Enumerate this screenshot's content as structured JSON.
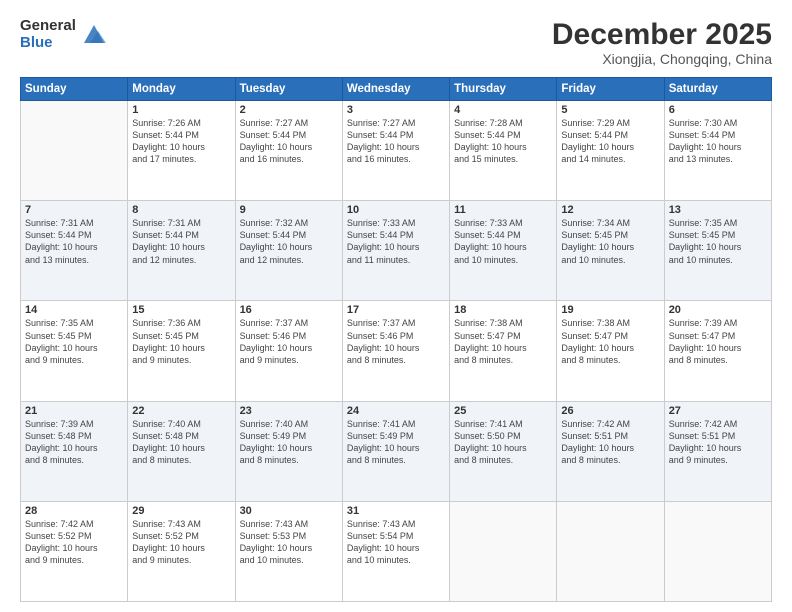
{
  "header": {
    "logo_general": "General",
    "logo_blue": "Blue",
    "month_title": "December 2025",
    "subtitle": "Xiongjia, Chongqing, China"
  },
  "days_of_week": [
    "Sunday",
    "Monday",
    "Tuesday",
    "Wednesday",
    "Thursday",
    "Friday",
    "Saturday"
  ],
  "weeks": [
    [
      {
        "day": "",
        "info": ""
      },
      {
        "day": "1",
        "info": "Sunrise: 7:26 AM\nSunset: 5:44 PM\nDaylight: 10 hours\nand 17 minutes."
      },
      {
        "day": "2",
        "info": "Sunrise: 7:27 AM\nSunset: 5:44 PM\nDaylight: 10 hours\nand 16 minutes."
      },
      {
        "day": "3",
        "info": "Sunrise: 7:27 AM\nSunset: 5:44 PM\nDaylight: 10 hours\nand 16 minutes."
      },
      {
        "day": "4",
        "info": "Sunrise: 7:28 AM\nSunset: 5:44 PM\nDaylight: 10 hours\nand 15 minutes."
      },
      {
        "day": "5",
        "info": "Sunrise: 7:29 AM\nSunset: 5:44 PM\nDaylight: 10 hours\nand 14 minutes."
      },
      {
        "day": "6",
        "info": "Sunrise: 7:30 AM\nSunset: 5:44 PM\nDaylight: 10 hours\nand 13 minutes."
      }
    ],
    [
      {
        "day": "7",
        "info": "Sunrise: 7:31 AM\nSunset: 5:44 PM\nDaylight: 10 hours\nand 13 minutes."
      },
      {
        "day": "8",
        "info": "Sunrise: 7:31 AM\nSunset: 5:44 PM\nDaylight: 10 hours\nand 12 minutes."
      },
      {
        "day": "9",
        "info": "Sunrise: 7:32 AM\nSunset: 5:44 PM\nDaylight: 10 hours\nand 12 minutes."
      },
      {
        "day": "10",
        "info": "Sunrise: 7:33 AM\nSunset: 5:44 PM\nDaylight: 10 hours\nand 11 minutes."
      },
      {
        "day": "11",
        "info": "Sunrise: 7:33 AM\nSunset: 5:44 PM\nDaylight: 10 hours\nand 10 minutes."
      },
      {
        "day": "12",
        "info": "Sunrise: 7:34 AM\nSunset: 5:45 PM\nDaylight: 10 hours\nand 10 minutes."
      },
      {
        "day": "13",
        "info": "Sunrise: 7:35 AM\nSunset: 5:45 PM\nDaylight: 10 hours\nand 10 minutes."
      }
    ],
    [
      {
        "day": "14",
        "info": "Sunrise: 7:35 AM\nSunset: 5:45 PM\nDaylight: 10 hours\nand 9 minutes."
      },
      {
        "day": "15",
        "info": "Sunrise: 7:36 AM\nSunset: 5:45 PM\nDaylight: 10 hours\nand 9 minutes."
      },
      {
        "day": "16",
        "info": "Sunrise: 7:37 AM\nSunset: 5:46 PM\nDaylight: 10 hours\nand 9 minutes."
      },
      {
        "day": "17",
        "info": "Sunrise: 7:37 AM\nSunset: 5:46 PM\nDaylight: 10 hours\nand 8 minutes."
      },
      {
        "day": "18",
        "info": "Sunrise: 7:38 AM\nSunset: 5:47 PM\nDaylight: 10 hours\nand 8 minutes."
      },
      {
        "day": "19",
        "info": "Sunrise: 7:38 AM\nSunset: 5:47 PM\nDaylight: 10 hours\nand 8 minutes."
      },
      {
        "day": "20",
        "info": "Sunrise: 7:39 AM\nSunset: 5:47 PM\nDaylight: 10 hours\nand 8 minutes."
      }
    ],
    [
      {
        "day": "21",
        "info": "Sunrise: 7:39 AM\nSunset: 5:48 PM\nDaylight: 10 hours\nand 8 minutes."
      },
      {
        "day": "22",
        "info": "Sunrise: 7:40 AM\nSunset: 5:48 PM\nDaylight: 10 hours\nand 8 minutes."
      },
      {
        "day": "23",
        "info": "Sunrise: 7:40 AM\nSunset: 5:49 PM\nDaylight: 10 hours\nand 8 minutes."
      },
      {
        "day": "24",
        "info": "Sunrise: 7:41 AM\nSunset: 5:49 PM\nDaylight: 10 hours\nand 8 minutes."
      },
      {
        "day": "25",
        "info": "Sunrise: 7:41 AM\nSunset: 5:50 PM\nDaylight: 10 hours\nand 8 minutes."
      },
      {
        "day": "26",
        "info": "Sunrise: 7:42 AM\nSunset: 5:51 PM\nDaylight: 10 hours\nand 8 minutes."
      },
      {
        "day": "27",
        "info": "Sunrise: 7:42 AM\nSunset: 5:51 PM\nDaylight: 10 hours\nand 9 minutes."
      }
    ],
    [
      {
        "day": "28",
        "info": "Sunrise: 7:42 AM\nSunset: 5:52 PM\nDaylight: 10 hours\nand 9 minutes."
      },
      {
        "day": "29",
        "info": "Sunrise: 7:43 AM\nSunset: 5:52 PM\nDaylight: 10 hours\nand 9 minutes."
      },
      {
        "day": "30",
        "info": "Sunrise: 7:43 AM\nSunset: 5:53 PM\nDaylight: 10 hours\nand 10 minutes."
      },
      {
        "day": "31",
        "info": "Sunrise: 7:43 AM\nSunset: 5:54 PM\nDaylight: 10 hours\nand 10 minutes."
      },
      {
        "day": "",
        "info": ""
      },
      {
        "day": "",
        "info": ""
      },
      {
        "day": "",
        "info": ""
      }
    ]
  ]
}
